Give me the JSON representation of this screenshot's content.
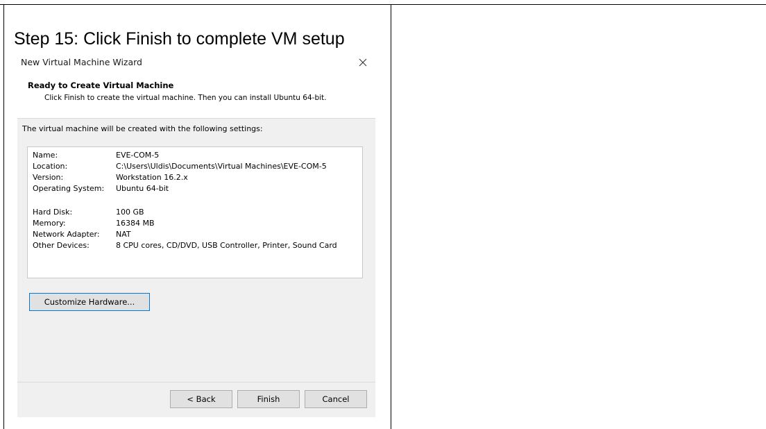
{
  "step_heading": "Step 15: Click Finish to complete VM setup",
  "dialog": {
    "title": "New Virtual Machine Wizard",
    "close_icon": "close-icon",
    "header": {
      "title": "Ready to Create Virtual Machine",
      "description": "Click Finish to create the virtual machine. Then you can install Ubuntu 64-bit."
    },
    "intro": "The virtual machine will be created with the following settings:",
    "settings": [
      {
        "label": "Name:",
        "value": "EVE-COM-5"
      },
      {
        "label": "Location:",
        "value": "C:\\Users\\Uldis\\Documents\\Virtual Machines\\EVE-COM-5"
      },
      {
        "label": "Version:",
        "value": "Workstation 16.2.x"
      },
      {
        "label": "Operating System:",
        "value": "Ubuntu 64-bit"
      },
      {
        "label": "Hard Disk:",
        "value": "100 GB"
      },
      {
        "label": "Memory:",
        "value": "16384 MB"
      },
      {
        "label": "Network Adapter:",
        "value": "NAT"
      },
      {
        "label": "Other Devices:",
        "value": "8 CPU cores, CD/DVD, USB Controller, Printer, Sound Card"
      }
    ],
    "customize_label": "Customize Hardware...",
    "buttons": {
      "back": "< Back",
      "finish": "Finish",
      "cancel": "Cancel"
    }
  },
  "colors": {
    "body_background": "#f0f0f0",
    "button_face": "#e1e1e1",
    "focus_border": "#0078d7"
  }
}
